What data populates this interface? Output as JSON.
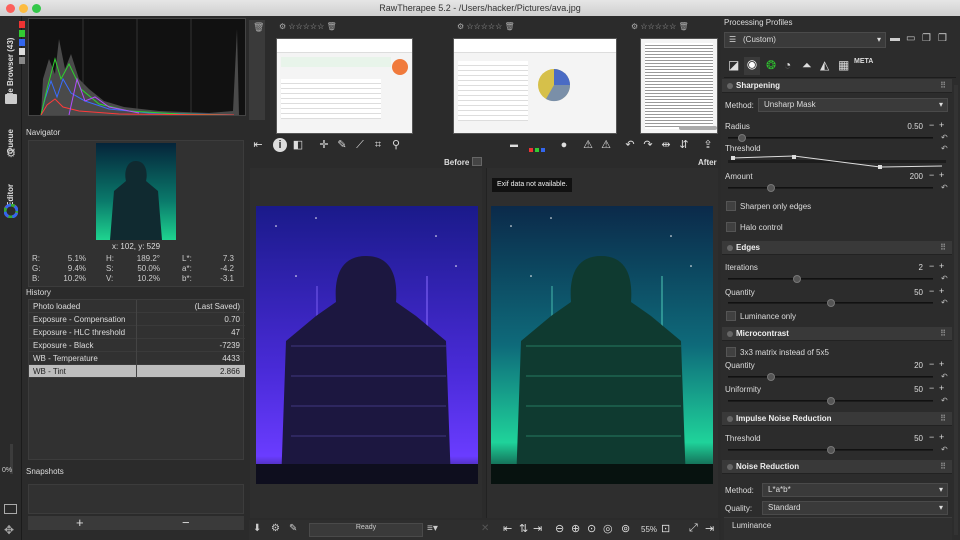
{
  "window": {
    "title": "RawTherapee 5.2 - /Users/hacker/Pictures/ava.jpg"
  },
  "vtabs": {
    "file_browser": "File Browser (43)",
    "queue": "Queue",
    "editor": "Editor",
    "progress": "0%"
  },
  "navigator": {
    "title": "Navigator",
    "coords": "x: 102, y: 529",
    "color": {
      "R": "5.1%",
      "G": "9.4%",
      "B": "10.2%",
      "H": "189.2°",
      "S": "50.0%",
      "V": "10.2%",
      "L": "7.3",
      "a": "-4.2",
      "b": "-3.1"
    }
  },
  "history": {
    "title": "History",
    "rows": [
      {
        "name": "Photo loaded",
        "value": "(Last Saved)"
      },
      {
        "name": "Exposure - Compensation",
        "value": "0.70"
      },
      {
        "name": "Exposure - HLC threshold",
        "value": "47"
      },
      {
        "name": "Exposure - Black",
        "value": "-7239"
      },
      {
        "name": "WB - Temperature",
        "value": "4433"
      },
      {
        "name": "WB - Tint",
        "value": "2.866"
      }
    ]
  },
  "snapshots": {
    "title": "Snapshots",
    "add": "+",
    "remove": "−"
  },
  "preview": {
    "before": "Before",
    "after": "After",
    "exif": "Exif data not available."
  },
  "status": {
    "ready": "Ready",
    "zoom": "55%"
  },
  "profiles": {
    "title": "Processing Profiles",
    "current": "(Custom)"
  },
  "sharpening": {
    "title": "Sharpening",
    "method_label": "Method:",
    "method_value": "Unsharp Mask",
    "radius_label": "Radius",
    "radius_value": "0.50",
    "radius_frac": 0.05,
    "threshold_label": "Threshold",
    "amount_label": "Amount",
    "amount_value": "200",
    "amount_frac": 0.2,
    "sharpen_edges_label": "Sharpen only edges",
    "halo_label": "Halo control"
  },
  "edges": {
    "title": "Edges",
    "iterations_label": "Iterations",
    "iterations_value": "2",
    "iterations_frac": 0.33,
    "quantity_label": "Quantity",
    "quantity_value": "50",
    "quantity_frac": 0.5,
    "luminance_only_label": "Luminance only"
  },
  "microcontrast": {
    "title": "Microcontrast",
    "matrix_label": "3x3 matrix instead of 5x5",
    "quantity_label": "Quantity",
    "quantity_value": "20",
    "quantity_frac": 0.2,
    "uniformity_label": "Uniformity",
    "uniformity_value": "50",
    "uniformity_frac": 0.5
  },
  "impulse": {
    "title": "Impulse Noise Reduction",
    "threshold_label": "Threshold",
    "threshold_value": "50",
    "threshold_frac": 0.5
  },
  "noise": {
    "title": "Noise Reduction",
    "method_label": "Method:",
    "method_value": "L*a*b*",
    "quality_label": "Quality:",
    "quality_value": "Standard",
    "luminance_label": "Luminance"
  }
}
